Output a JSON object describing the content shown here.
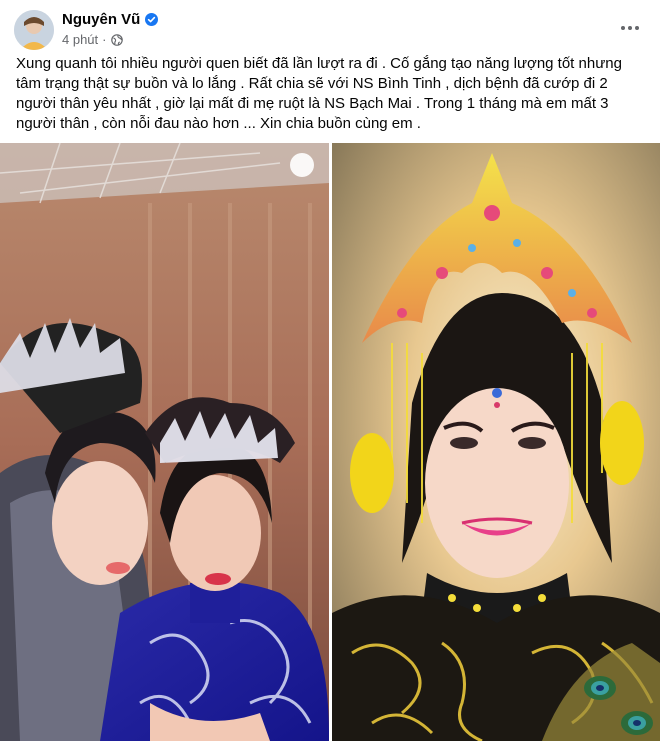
{
  "author": {
    "name": "Nguyên Vũ",
    "verified": true
  },
  "meta": {
    "time": "4 phút",
    "separator": "·",
    "audience_icon": "globe-icon"
  },
  "post": {
    "text": "Xung quanh tôi nhiều người quen biết đã lần lượt ra đi . Cố gắng tạo năng lượng tốt nhưng tâm trạng thật sự buồn và lo lắng . Rất chia sẽ với NS Bình Tinh , dịch bệnh đã cướp đi 2 người thân yêu nhất , giờ lại mất đi mẹ ruột là NS Bạch Mai . Trong 1 tháng mà em mất 3 người thân , còn nỗi đau nào hơn ... Xin chia buồn cùng em ."
  },
  "photos": [
    {
      "description_icon": "photo-two-performers"
    },
    {
      "description_icon": "photo-portrait"
    }
  ],
  "colors": {
    "accent": "#1877f2",
    "secondary_text": "#65676b"
  }
}
